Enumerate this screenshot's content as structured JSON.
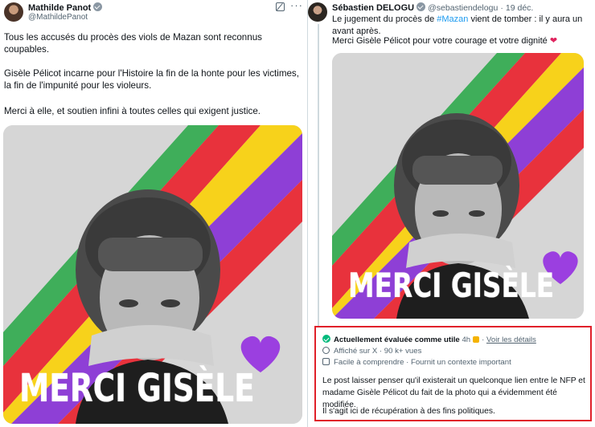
{
  "left_tweet": {
    "author_name": "Mathilde Panot",
    "author_handle": "@MathildePanot",
    "more_label": "···",
    "paragraphs": [
      "Tous les accusés du procès des viols de Mazan sont reconnus coupables.",
      "Gisèle Pélicot incarne pour l'Histoire la fin de la honte pour les victimes, la fin de l'impunité pour les violeurs.",
      "Merci à elle, et soutien infini à toutes celles qui exigent justice."
    ],
    "image_caption": "MERCI GISÈLE"
  },
  "right_tweet": {
    "author_name": "Sébastien DELOGU",
    "author_handle": "@sebastiendelogu",
    "date": "19 déc.",
    "line1_before": "Le jugement du procès de ",
    "hashtag": "#Mazan",
    "line1_after": " vient de tomber : il y aura un avant après.",
    "line2": "Merci Gisèle Pélicot pour votre courage et votre dignité",
    "heart": "❤",
    "image_caption": "MERCI GISÈLE"
  },
  "community_note": {
    "status_label": "Actuellement évaluée comme utile",
    "age": "4h",
    "details_link": "Voir les détails",
    "seen": "Affiché sur X · 90 k+ vues",
    "reasons": "Facile à comprendre · Fournit un contexte important",
    "body": "Le post laisser penser qu'il existerait un quelconque lien entre le NFP et madame Gisèle Pélicot du fait de la photo qui a évidemment été modifiée.",
    "body2": "Il s'agit ici de récupération à des fins politiques."
  },
  "colors": {
    "stripe_green": "#3fae5a",
    "stripe_red": "#e8323c",
    "stripe_yellow": "#f7d21b",
    "stripe_purple": "#8e3fd6",
    "note_border": "#e0202a",
    "link_blue": "#1d9bf0"
  }
}
